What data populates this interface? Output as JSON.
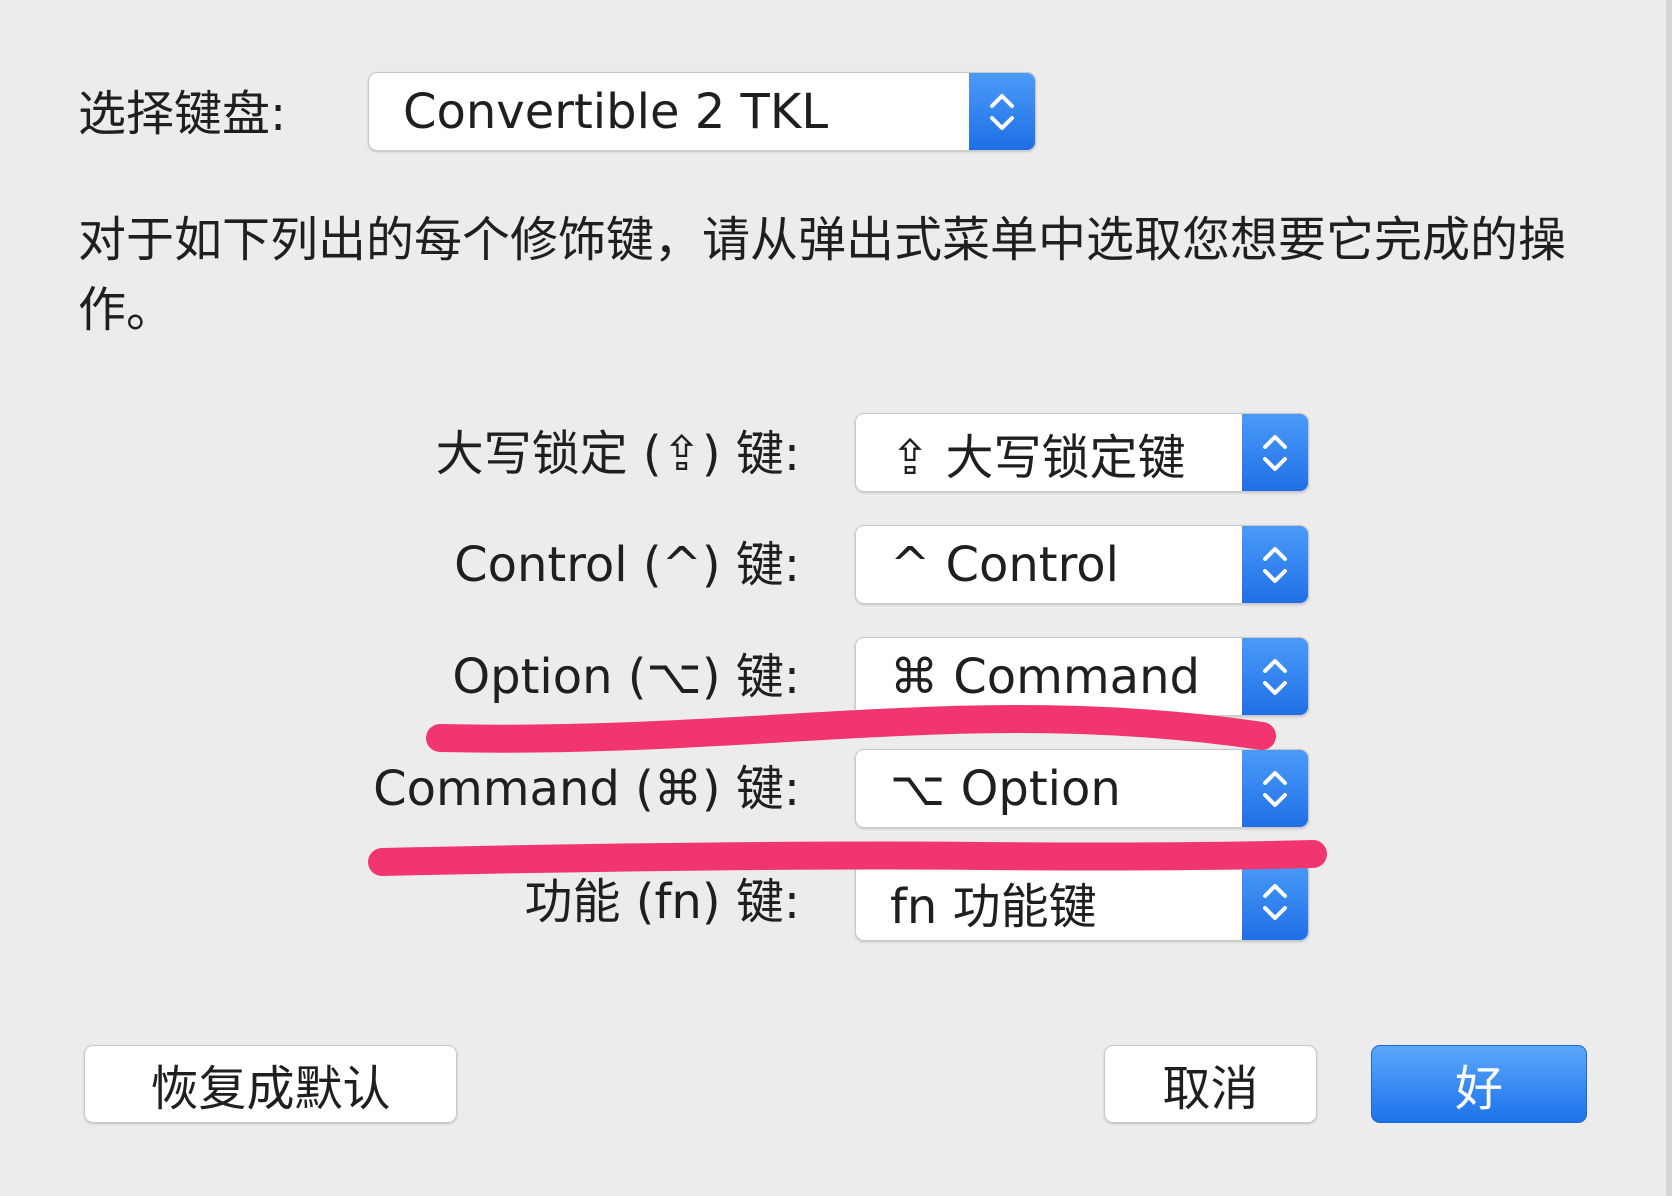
{
  "keyboard_select": {
    "label": "选择键盘:",
    "value": "Convertible 2 TKL"
  },
  "description": "对于如下列出的每个修饰键，请从弹出式菜单中选取您想要它完成的操作。",
  "modifiers": [
    {
      "label": "大写锁定 (⇪) 键:",
      "value": "⇪ 大写锁定键"
    },
    {
      "label": "Control (^) 键:",
      "value": "^ Control"
    },
    {
      "label": "Option (⌥) 键:",
      "value": "⌘ Command"
    },
    {
      "label": "Command (⌘) 键:",
      "value": "⌥ Option"
    },
    {
      "label": "功能 (fn) 键:",
      "value": "fn 功能键"
    }
  ],
  "buttons": {
    "restore_defaults": "恢复成默认",
    "cancel": "取消",
    "ok": "好"
  },
  "colors": {
    "accent": "#2a7ff0",
    "highlight_mark": "#f0356f",
    "background": "#ececec"
  }
}
